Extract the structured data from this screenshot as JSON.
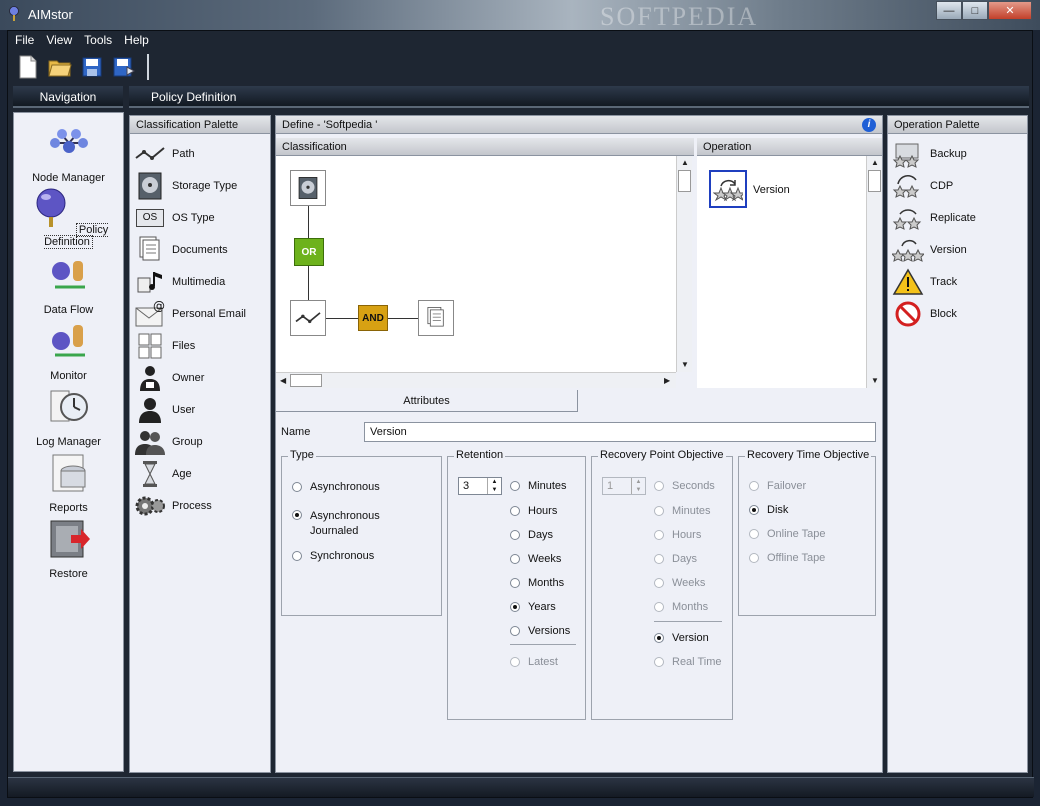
{
  "window": {
    "title": "AIMstor",
    "watermark": "SOFTPEDIA"
  },
  "menu": [
    "File",
    "View",
    "Tools",
    "Help"
  ],
  "sections": {
    "navigation": "Navigation",
    "policy_definition": "Policy Definition"
  },
  "nav_items": [
    {
      "label": "Node Manager",
      "icon": "node-manager-icon"
    },
    {
      "label": "Policy Definition",
      "icon": "policy-definition-icon"
    },
    {
      "label": "Data Flow",
      "icon": "data-flow-icon"
    },
    {
      "label": "Monitor",
      "icon": "monitor-icon"
    },
    {
      "label": "Log Manager",
      "icon": "log-manager-icon"
    },
    {
      "label": "Reports",
      "icon": "reports-icon"
    },
    {
      "label": "Restore",
      "icon": "restore-icon"
    }
  ],
  "classification_palette": {
    "title": "Classification Palette",
    "items": [
      "Path",
      "Storage Type",
      "OS Type",
      "Documents",
      "Multimedia",
      "Personal Email",
      "Files",
      "Owner",
      "User",
      "Group",
      "Age",
      "Process"
    ],
    "os_badge": "OS"
  },
  "define": {
    "title": "Define - 'Softpedia '",
    "classification_title": "Classification",
    "operation_title": "Operation",
    "or_label": "OR",
    "and_label": "AND",
    "operation_node": "Version"
  },
  "operation_palette": {
    "title": "Operation Palette",
    "items": [
      "Backup",
      "CDP",
      "Replicate",
      "Version",
      "Track",
      "Block"
    ]
  },
  "attributes": {
    "tab": "Attributes",
    "name_label": "Name",
    "name_value": "Version",
    "type": {
      "title": "Type",
      "options": [
        "Asynchronous",
        "Asynchronous Journaled",
        "Synchronous"
      ],
      "selected": "Asynchronous Journaled"
    },
    "retention": {
      "title": "Retention",
      "value": "3",
      "options": [
        "Minutes",
        "Hours",
        "Days",
        "Weeks",
        "Months",
        "Years",
        "Versions"
      ],
      "selected": "Years",
      "extra": "Latest"
    },
    "rpo": {
      "title": "Recovery Point Objective",
      "value": "1",
      "options": [
        "Seconds",
        "Minutes",
        "Hours",
        "Days",
        "Weeks",
        "Months"
      ],
      "mode_options": [
        "Version",
        "Real Time"
      ],
      "selected": "Version"
    },
    "rto": {
      "title": "Recovery Time Objective",
      "options": [
        "Failover",
        "Disk",
        "Online Tape",
        "Offline Tape"
      ],
      "selected": "Disk"
    }
  },
  "colors": {
    "or_node": "#6db21c",
    "and_node": "#d7a113",
    "panel_bg": "#eef0f7",
    "frame_bg": "#1e2632"
  }
}
